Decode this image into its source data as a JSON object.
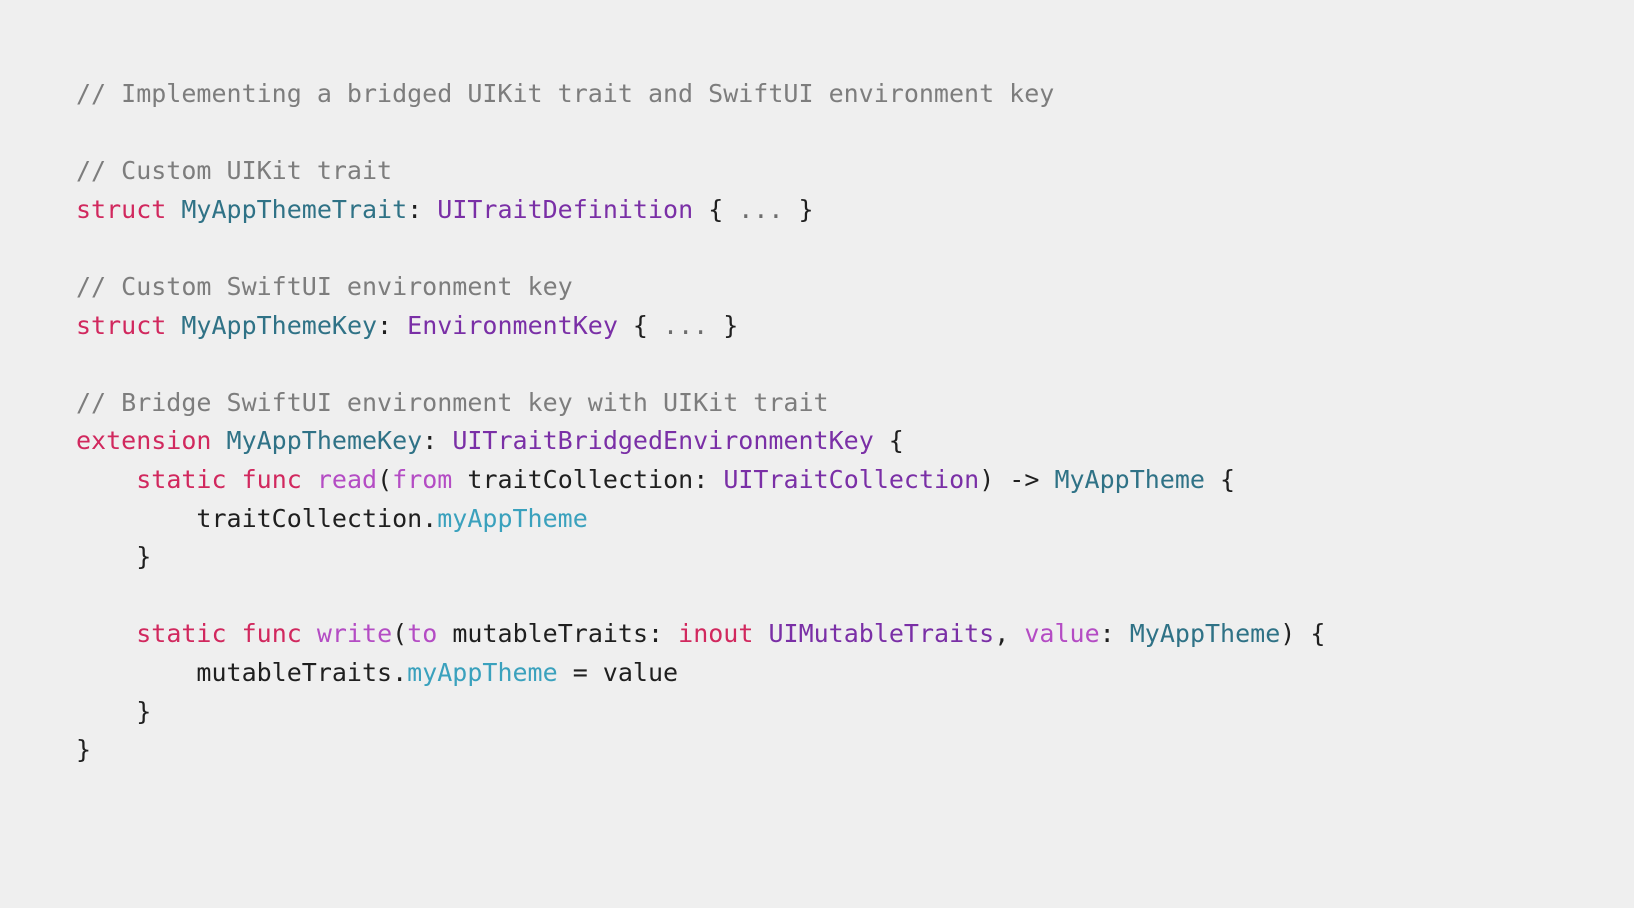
{
  "code": {
    "lines": [
      [
        {
          "kind": "comment",
          "text": "// Implementing a bridged UIKit trait and SwiftUI environment key"
        }
      ],
      [],
      [
        {
          "kind": "comment",
          "text": "// Custom UIKit trait"
        }
      ],
      [
        {
          "kind": "keyword",
          "text": "struct"
        },
        {
          "kind": "plain",
          "text": " "
        },
        {
          "kind": "typedecl",
          "text": "MyAppThemeTrait"
        },
        {
          "kind": "punct",
          "text": ": "
        },
        {
          "kind": "type",
          "text": "UITraitDefinition"
        },
        {
          "kind": "punct",
          "text": " { "
        },
        {
          "kind": "ellipsis",
          "text": "..."
        },
        {
          "kind": "punct",
          "text": " }"
        }
      ],
      [],
      [
        {
          "kind": "comment",
          "text": "// Custom SwiftUI environment key"
        }
      ],
      [
        {
          "kind": "keyword",
          "text": "struct"
        },
        {
          "kind": "plain",
          "text": " "
        },
        {
          "kind": "typedecl",
          "text": "MyAppThemeKey"
        },
        {
          "kind": "punct",
          "text": ": "
        },
        {
          "kind": "type",
          "text": "EnvironmentKey"
        },
        {
          "kind": "punct",
          "text": " { "
        },
        {
          "kind": "ellipsis",
          "text": "..."
        },
        {
          "kind": "punct",
          "text": " }"
        }
      ],
      [],
      [
        {
          "kind": "comment",
          "text": "// Bridge SwiftUI environment key with UIKit trait"
        }
      ],
      [
        {
          "kind": "keyword",
          "text": "extension"
        },
        {
          "kind": "plain",
          "text": " "
        },
        {
          "kind": "typedecl",
          "text": "MyAppThemeKey"
        },
        {
          "kind": "punct",
          "text": ": "
        },
        {
          "kind": "type",
          "text": "UITraitBridgedEnvironmentKey"
        },
        {
          "kind": "punct",
          "text": " {"
        }
      ],
      [
        {
          "kind": "plain",
          "text": "    "
        },
        {
          "kind": "keyword",
          "text": "static"
        },
        {
          "kind": "plain",
          "text": " "
        },
        {
          "kind": "keyword",
          "text": "func"
        },
        {
          "kind": "plain",
          "text": " "
        },
        {
          "kind": "func",
          "text": "read"
        },
        {
          "kind": "punct",
          "text": "("
        },
        {
          "kind": "param",
          "text": "from"
        },
        {
          "kind": "plain",
          "text": " traitCollection"
        },
        {
          "kind": "punct",
          "text": ": "
        },
        {
          "kind": "type",
          "text": "UITraitCollection"
        },
        {
          "kind": "punct",
          "text": ") -> "
        },
        {
          "kind": "typedecl",
          "text": "MyAppTheme"
        },
        {
          "kind": "punct",
          "text": " {"
        }
      ],
      [
        {
          "kind": "plain",
          "text": "        traitCollection."
        },
        {
          "kind": "property",
          "text": "myAppTheme"
        }
      ],
      [
        {
          "kind": "punct",
          "text": "    }"
        }
      ],
      [],
      [
        {
          "kind": "plain",
          "text": "    "
        },
        {
          "kind": "keyword",
          "text": "static"
        },
        {
          "kind": "plain",
          "text": " "
        },
        {
          "kind": "keyword",
          "text": "func"
        },
        {
          "kind": "plain",
          "text": " "
        },
        {
          "kind": "func",
          "text": "write"
        },
        {
          "kind": "punct",
          "text": "("
        },
        {
          "kind": "param",
          "text": "to"
        },
        {
          "kind": "plain",
          "text": " mutableTraits"
        },
        {
          "kind": "punct",
          "text": ": "
        },
        {
          "kind": "keyword",
          "text": "inout"
        },
        {
          "kind": "plain",
          "text": " "
        },
        {
          "kind": "type",
          "text": "UIMutableTraits"
        },
        {
          "kind": "punct",
          "text": ", "
        },
        {
          "kind": "param",
          "text": "value"
        },
        {
          "kind": "punct",
          "text": ": "
        },
        {
          "kind": "typedecl",
          "text": "MyAppTheme"
        },
        {
          "kind": "punct",
          "text": ") {"
        }
      ],
      [
        {
          "kind": "plain",
          "text": "        mutableTraits."
        },
        {
          "kind": "property",
          "text": "myAppTheme"
        },
        {
          "kind": "plain",
          "text": " = value"
        }
      ],
      [
        {
          "kind": "punct",
          "text": "    }"
        }
      ],
      [
        {
          "kind": "punct",
          "text": "}"
        }
      ]
    ]
  },
  "colors": {
    "background": "#efefef",
    "comment": "#7d7d7d",
    "keyword": "#d1285e",
    "type_declaration": "#2f7286",
    "type_reference": "#7a2fa6",
    "function_name": "#b44cc4",
    "property": "#3aa1bd",
    "plain_text": "#1f1f1f"
  }
}
